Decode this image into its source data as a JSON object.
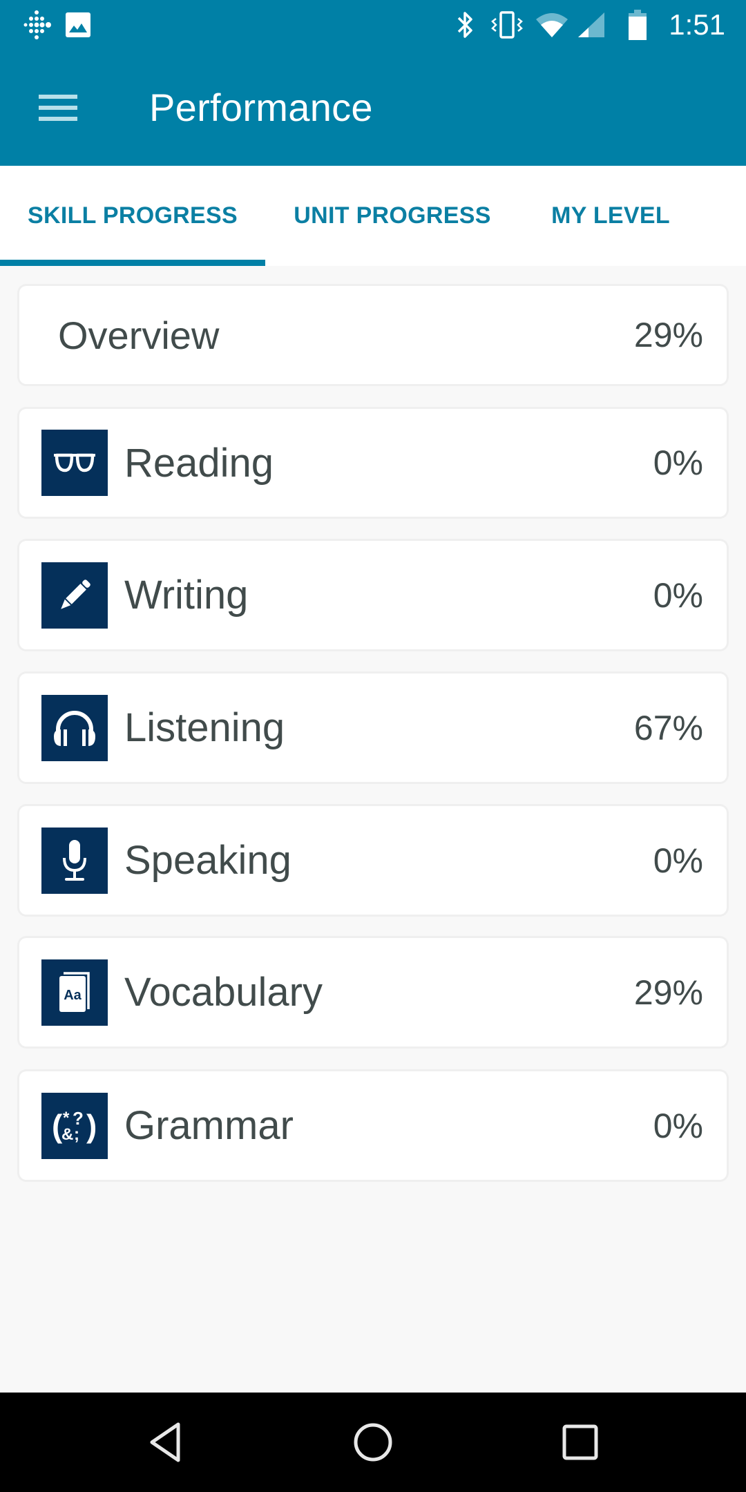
{
  "status_bar": {
    "left_icons": [
      "fitbit-icon",
      "image-notification-icon"
    ],
    "right_icons": [
      "bluetooth-icon",
      "vibrate-icon",
      "wifi-icon",
      "cell-signal-icon",
      "battery-icon"
    ],
    "time": "1:51"
  },
  "app_bar": {
    "menu_icon": "hamburger-menu-icon",
    "title": "Performance"
  },
  "tabs": [
    {
      "label": "SKILL PROGRESS",
      "selected": true
    },
    {
      "label": "UNIT PROGRESS",
      "selected": false
    },
    {
      "label": "MY LEVEL",
      "selected": false
    }
  ],
  "overview": {
    "label": "Overview",
    "percent": "29%",
    "value": 29
  },
  "skills": [
    {
      "label": "Reading",
      "percent": "0%",
      "value": 0,
      "icon": "glasses-icon"
    },
    {
      "label": "Writing",
      "percent": "0%",
      "value": 0,
      "icon": "pencil-icon"
    },
    {
      "label": "Listening",
      "percent": "67%",
      "value": 67,
      "icon": "headphones-icon"
    },
    {
      "label": "Speaking",
      "percent": "0%",
      "value": 0,
      "icon": "microphone-icon"
    },
    {
      "label": "Vocabulary",
      "percent": "29%",
      "value": 29,
      "icon": "dictionary-book-icon",
      "icon_text": "Aa"
    },
    {
      "label": "Grammar",
      "percent": "0%",
      "value": 0,
      "icon": "grammar-symbols-icon",
      "icon_text": "(*?&;)"
    }
  ],
  "colors": {
    "primary": "#0080a6",
    "tab_text": "#0b7fa3",
    "icon_box": "#05305a",
    "text": "#414b4b",
    "background": "#f8f8f8"
  },
  "nav_bar": {
    "buttons": [
      "back-icon",
      "home-icon",
      "recents-icon"
    ]
  }
}
